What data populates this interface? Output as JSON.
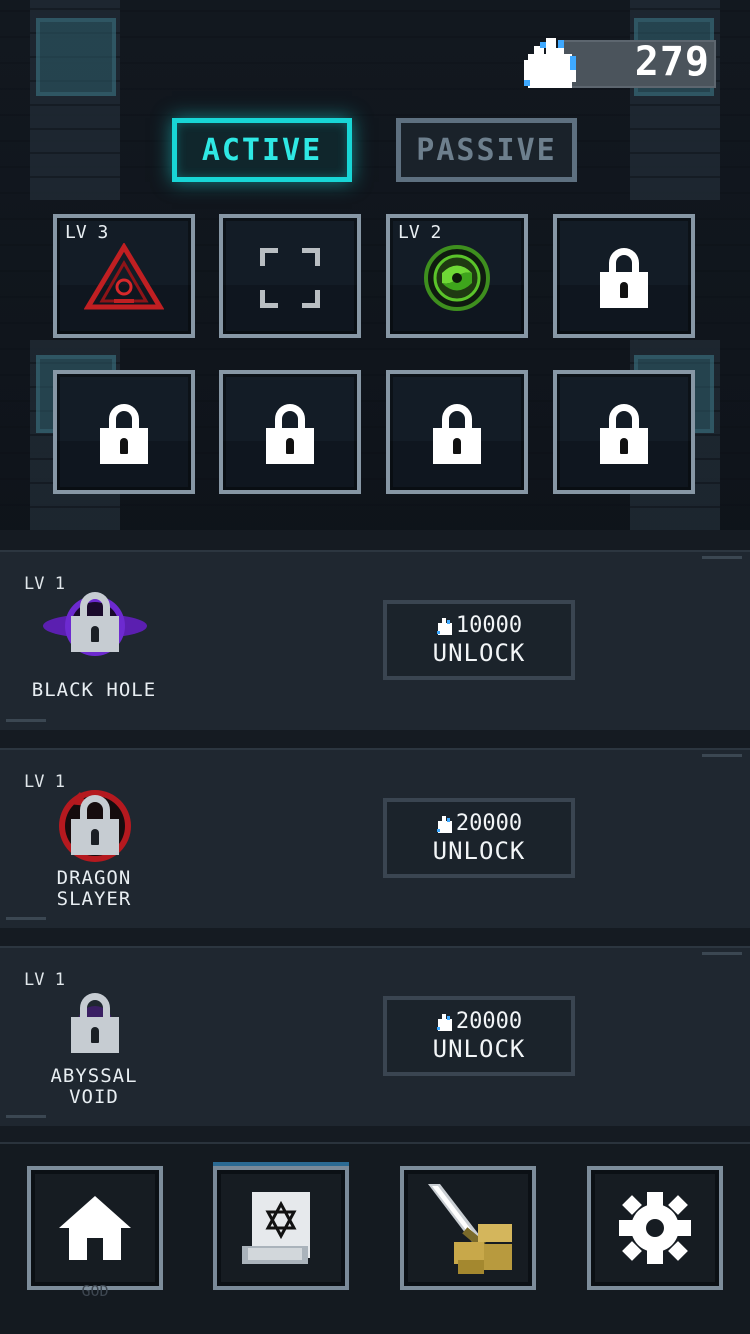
{
  "currency": {
    "value": "279",
    "icon": "blue-flame-icon"
  },
  "tabs": {
    "active_label": "ACTIVE",
    "passive_label": "PASSIVE"
  },
  "slots": [
    {
      "level": "LV 3",
      "icon": "red-triangle-sigil-icon"
    },
    {
      "level": "",
      "icon": "empty-frame-icon"
    },
    {
      "level": "LV 2",
      "icon": "green-vortex-icon"
    },
    {
      "level": "",
      "icon": "lock-icon"
    },
    {
      "level": "",
      "icon": "lock-icon"
    },
    {
      "level": "",
      "icon": "lock-icon"
    },
    {
      "level": "",
      "icon": "lock-icon"
    },
    {
      "level": "",
      "icon": "lock-icon"
    }
  ],
  "skills": [
    {
      "level": "LV 1",
      "name_line1": "BLACK HOLE",
      "name_line2": "",
      "cost": "10000",
      "button": "UNLOCK",
      "icon": "black-hole-icon",
      "accent": "#7a2fd6"
    },
    {
      "level": "LV 1",
      "name_line1": "DRAGON",
      "name_line2": "SLAYER",
      "cost": "20000",
      "button": "UNLOCK",
      "icon": "dragon-slayer-icon",
      "accent": "#c2242a"
    },
    {
      "level": "LV 1",
      "name_line1": "ABYSSAL",
      "name_line2": "VOID",
      "cost": "20000",
      "button": "UNLOCK",
      "icon": "abyssal-void-icon",
      "accent": "#4b2a7a"
    }
  ],
  "nav": {
    "items": [
      {
        "icon": "home-icon"
      },
      {
        "icon": "spell-scroll-icon",
        "selected": true
      },
      {
        "icon": "sword-gold-icon"
      },
      {
        "icon": "gear-icon"
      }
    ],
    "faded_label": "GOD"
  }
}
